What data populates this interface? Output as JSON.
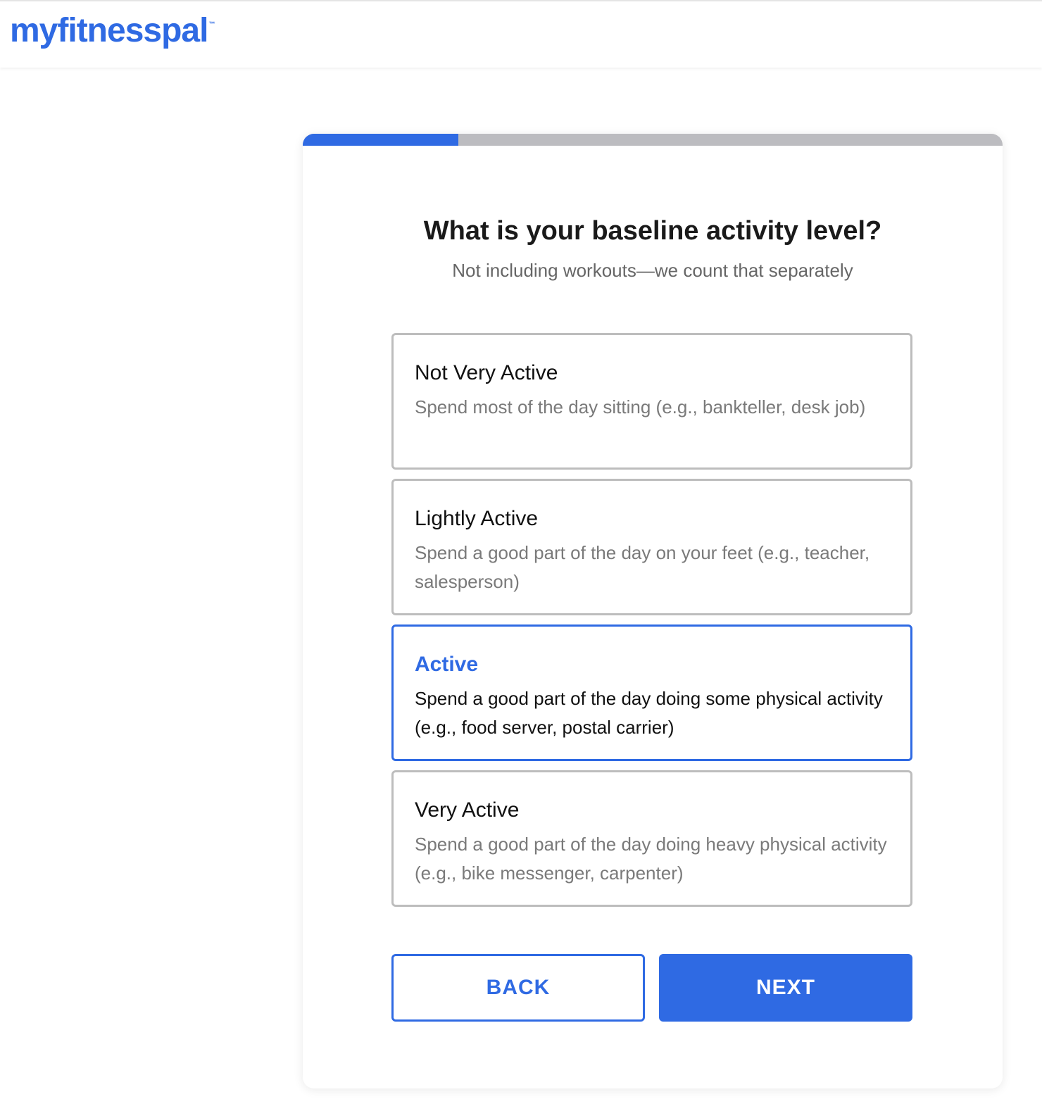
{
  "header": {
    "logo_text": "myfitnesspal",
    "logo_tm": "™"
  },
  "progress": {
    "fraction": 0.222
  },
  "question": {
    "title": "What is your baseline activity level?",
    "subtitle": "Not including workouts—we count that separately"
  },
  "options": [
    {
      "title": "Not Very Active",
      "description": "Spend most of the day sitting (e.g., bankteller, desk job)",
      "selected": false
    },
    {
      "title": "Lightly Active",
      "description": "Spend a good part of the day on your feet (e.g., teacher, salesperson)",
      "selected": false
    },
    {
      "title": "Active",
      "description": "Spend a good part of the day doing some physical activity (e.g., food server, postal carrier)",
      "selected": true
    },
    {
      "title": "Very Active",
      "description": "Spend a good part of the day doing heavy physical activity (e.g., bike messenger, carpenter)",
      "selected": false
    }
  ],
  "buttons": {
    "back_label": "BACK",
    "next_label": "NEXT"
  },
  "colors": {
    "brand_blue": "#2f6ae3",
    "track_gray": "#bcbcc0",
    "border_gray": "#bdbdbd",
    "muted_text": "#7a7a7a"
  }
}
